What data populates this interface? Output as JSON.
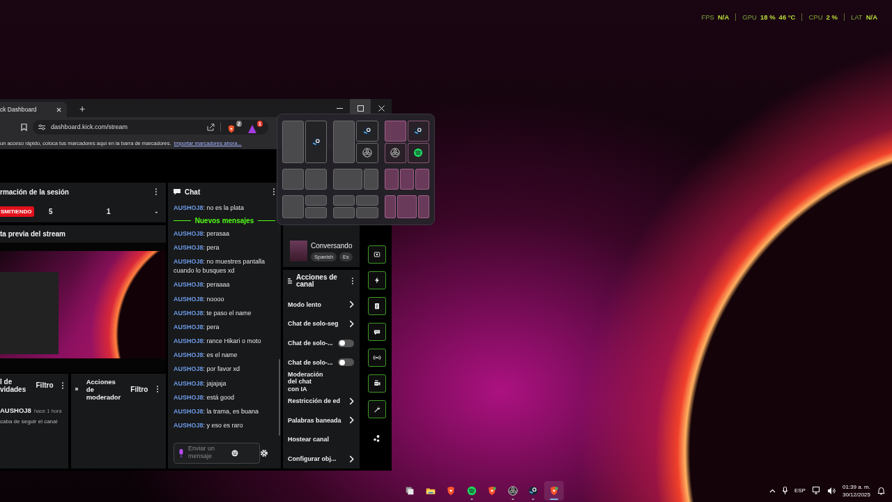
{
  "overlay_stats": [
    {
      "label": "FPS",
      "values": [
        "N/A"
      ]
    },
    {
      "label": "GPU",
      "values": [
        "18 %",
        "46 °C"
      ]
    },
    {
      "label": "CPU",
      "values": [
        "2 %"
      ]
    },
    {
      "label": "LAT",
      "values": [
        "N/A"
      ]
    }
  ],
  "browser": {
    "tab_title": "ck Dashboard",
    "new_tab": "+",
    "url": "dashboard.kick.com/stream",
    "extension_badges": [
      "2",
      "1"
    ],
    "bookmarks_hint": "un acceso rápido, coloca tus marcadores aquí en la barra de marcadores.",
    "bookmarks_link": "Importar marcadores ahora..."
  },
  "session": {
    "title": "rmación de la sesión",
    "status": "SMITIENDO",
    "stats": [
      "5",
      "1",
      "-"
    ]
  },
  "preview": {
    "title": "ta previa del stream"
  },
  "activity": {
    "title": "l de vidades",
    "filter": "Filtro",
    "events": [
      {
        "user": "AUSHOJ8",
        "time": "hace 1 hora",
        "text": "caba de seguir el canal"
      }
    ]
  },
  "mod_actions": {
    "title": "Acciones de moderador",
    "filter": "Filtro"
  },
  "chat": {
    "title": "Chat",
    "placeholder": "Enviar un mensaje",
    "items": [
      {
        "kind": "message",
        "user": "AUSHOJ8",
        "text": ": no es la plata"
      },
      {
        "kind": "divider",
        "text": "Nuevos mensajes"
      },
      {
        "kind": "message",
        "user": "AUSHOJ8",
        "text": ": perasaa"
      },
      {
        "kind": "message",
        "user": "AUSHOJ8",
        "text": ": pera"
      },
      {
        "kind": "message",
        "user": "AUSHOJ8",
        "text": ": no muestres pantalla cuando lo busques xd"
      },
      {
        "kind": "message",
        "user": "AUSHOJ8",
        "text": ": peraaaa"
      },
      {
        "kind": "message",
        "user": "AUSHOJ8",
        "text": ": noooo"
      },
      {
        "kind": "message",
        "user": "AUSHOJ8",
        "text": ": te paso el name"
      },
      {
        "kind": "message",
        "user": "AUSHOJ8",
        "text": ": pera"
      },
      {
        "kind": "message",
        "user": "AUSHOJ8",
        "text": ": rance Hikari o moto"
      },
      {
        "kind": "message",
        "user": "AUSHOJ8",
        "text": ": es el name"
      },
      {
        "kind": "message",
        "user": "AUSHOJ8",
        "text": ": por favor xd"
      },
      {
        "kind": "message",
        "user": "AUSHOJ8",
        "text": ": jajajaja"
      },
      {
        "kind": "message",
        "user": "AUSHOJ8",
        "text": ": está good"
      },
      {
        "kind": "message",
        "user": "AUSHOJ8",
        "text": ": la trama, es buana"
      },
      {
        "kind": "message",
        "user": "AUSHOJ8",
        "text": ": y eso es raro"
      }
    ]
  },
  "stream_card": {
    "title": "Conversando",
    "tags": [
      "Spanish",
      "Es"
    ]
  },
  "channel_actions": {
    "title": "Acciones de canal",
    "items": [
      {
        "kind": "link",
        "label": "Modo lento"
      },
      {
        "kind": "link",
        "label": "Chat de solo-seg"
      },
      {
        "kind": "toggle",
        "label": "Chat de solo-...",
        "on": false
      },
      {
        "kind": "toggle",
        "label": "Chat de solo-...",
        "on": false
      },
      {
        "kind": "external",
        "label": "Moderación del chat con IA"
      },
      {
        "kind": "link",
        "label": "Restricción de ed"
      },
      {
        "kind": "link",
        "label": "Palabras baneada"
      },
      {
        "kind": "plain",
        "label": "Hostear canal"
      },
      {
        "kind": "link",
        "label": "Configurar obj..."
      }
    ]
  },
  "taskbar": {
    "apps": [
      {
        "running": false,
        "selected": false
      },
      {
        "running": false,
        "selected": false
      },
      {
        "running": false,
        "selected": false
      },
      {
        "running": true,
        "selected": false
      },
      {
        "running": false,
        "selected": false
      },
      {
        "running": true,
        "selected": false
      },
      {
        "running": true,
        "selected": false
      },
      {
        "running": true,
        "selected": true
      }
    ],
    "language": "ESP",
    "time": "01:39 a. m.",
    "date": "30/12/2025"
  }
}
